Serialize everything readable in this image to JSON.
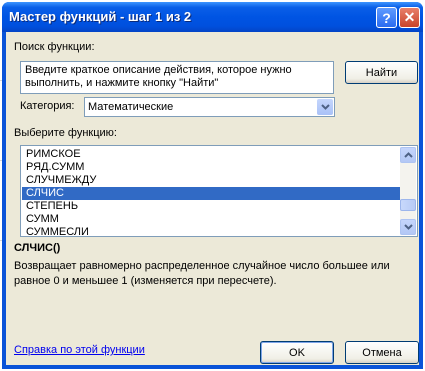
{
  "window": {
    "title": "Мастер функций - шаг 1 из 2",
    "help_glyph": "?",
    "close_glyph": "✕"
  },
  "search": {
    "label": "Поиск функции:",
    "value": "Введите краткое описание действия, которое нужно выполнить, и нажмите кнопку \"Найти\"",
    "find_button": "Найти"
  },
  "category": {
    "label": "Категория:",
    "selected": "Математические"
  },
  "functions": {
    "label": "Выберите функцию:",
    "items": [
      "РИМСКОЕ",
      "РЯД.СУММ",
      "СЛУЧМЕЖДУ",
      "СЛЧИС",
      "СТЕПЕНЬ",
      "СУММ",
      "СУММЕСЛИ"
    ],
    "selected": "СЛЧИС",
    "selected_signature": "СЛЧИС()",
    "description": "Возвращает равномерно распределенное случайное число большее или равное 0 и меньшее 1 (изменяется при пересчете)."
  },
  "footer": {
    "help_link": "Справка по этой функции",
    "ok_button": "OK",
    "cancel_button": "Отмена"
  },
  "colors": {
    "titlebar": "#0054e3",
    "dialog_bg": "#ece9d8",
    "selection": "#316ac5",
    "link": "#0000ee"
  }
}
